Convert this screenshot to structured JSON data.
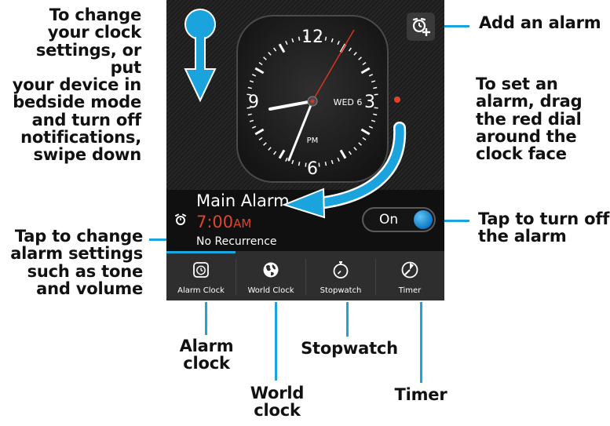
{
  "callouts": {
    "swipe_down": [
      "To change",
      "your clock",
      "settings, or put",
      "your device in",
      "bedside mode",
      "and turn off",
      "notifications,",
      "swipe down"
    ],
    "add_alarm": "Add an alarm",
    "set_alarm": [
      "To set an",
      "alarm, drag",
      "the red dial",
      "around the",
      "clock face"
    ],
    "tap_turn_off": [
      "Tap to turn off",
      "the alarm"
    ],
    "alarm_settings": [
      "Tap to change",
      "alarm settings",
      "such as tone",
      "and volume"
    ],
    "alarm_clock": [
      "Alarm",
      "clock"
    ],
    "world_clock": [
      "World",
      "clock"
    ],
    "stopwatch": "Stopwatch",
    "timer": "Timer"
  },
  "clock": {
    "date_label": "WED 6",
    "period": "PM",
    "numerals": {
      "n12": "12",
      "n3": "3",
      "n6": "6",
      "n9": "9"
    }
  },
  "alarm": {
    "name": "Main Alarm",
    "time": "7:00",
    "ampm": "AM",
    "recurrence": "No Recurrence",
    "toggle_label": "On"
  },
  "tabs": [
    {
      "label": "Alarm Clock",
      "icon": "alarm-clock-icon"
    },
    {
      "label": "World Clock",
      "icon": "globe-icon"
    },
    {
      "label": "Stopwatch",
      "icon": "stopwatch-icon"
    },
    {
      "label": "Timer",
      "icon": "timer-icon"
    }
  ],
  "colors": {
    "accent_blue": "#1aa3dc",
    "alarm_red": "#e0452b",
    "screen_bg": "#1f1f1f"
  }
}
